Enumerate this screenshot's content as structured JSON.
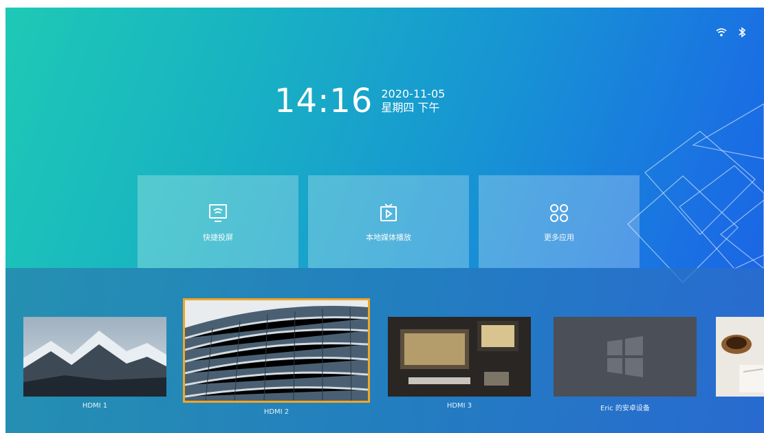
{
  "status": {
    "wifi_icon": "wifi-icon",
    "bluetooth_icon": "bluetooth-icon"
  },
  "clock": {
    "time": "14:16",
    "date": "2020-11-05",
    "weekday": "星期四 下午"
  },
  "quick_tiles": [
    {
      "label": "快捷投屏",
      "icon": "screen-cast-icon"
    },
    {
      "label": "本地媒体播放",
      "icon": "media-play-icon"
    },
    {
      "label": "更多应用",
      "icon": "apps-grid-icon"
    }
  ],
  "sources": [
    {
      "label": "HDMI 1",
      "thumbnail": "mountain-landscape"
    },
    {
      "label": "HDMI 2",
      "thumbnail": "curved-building",
      "selected": true
    },
    {
      "label": "HDMI 3",
      "thumbnail": "desk-monitor"
    },
    {
      "label": "Eric 的安卓设备",
      "thumbnail": "windows-logo-placeholder"
    },
    {
      "label": "",
      "thumbnail": "coffee-desk"
    }
  ],
  "colors": {
    "accent_selected": "#f5a623",
    "bg_start": "#1ec9b5",
    "bg_end": "#1c5fe6"
  }
}
